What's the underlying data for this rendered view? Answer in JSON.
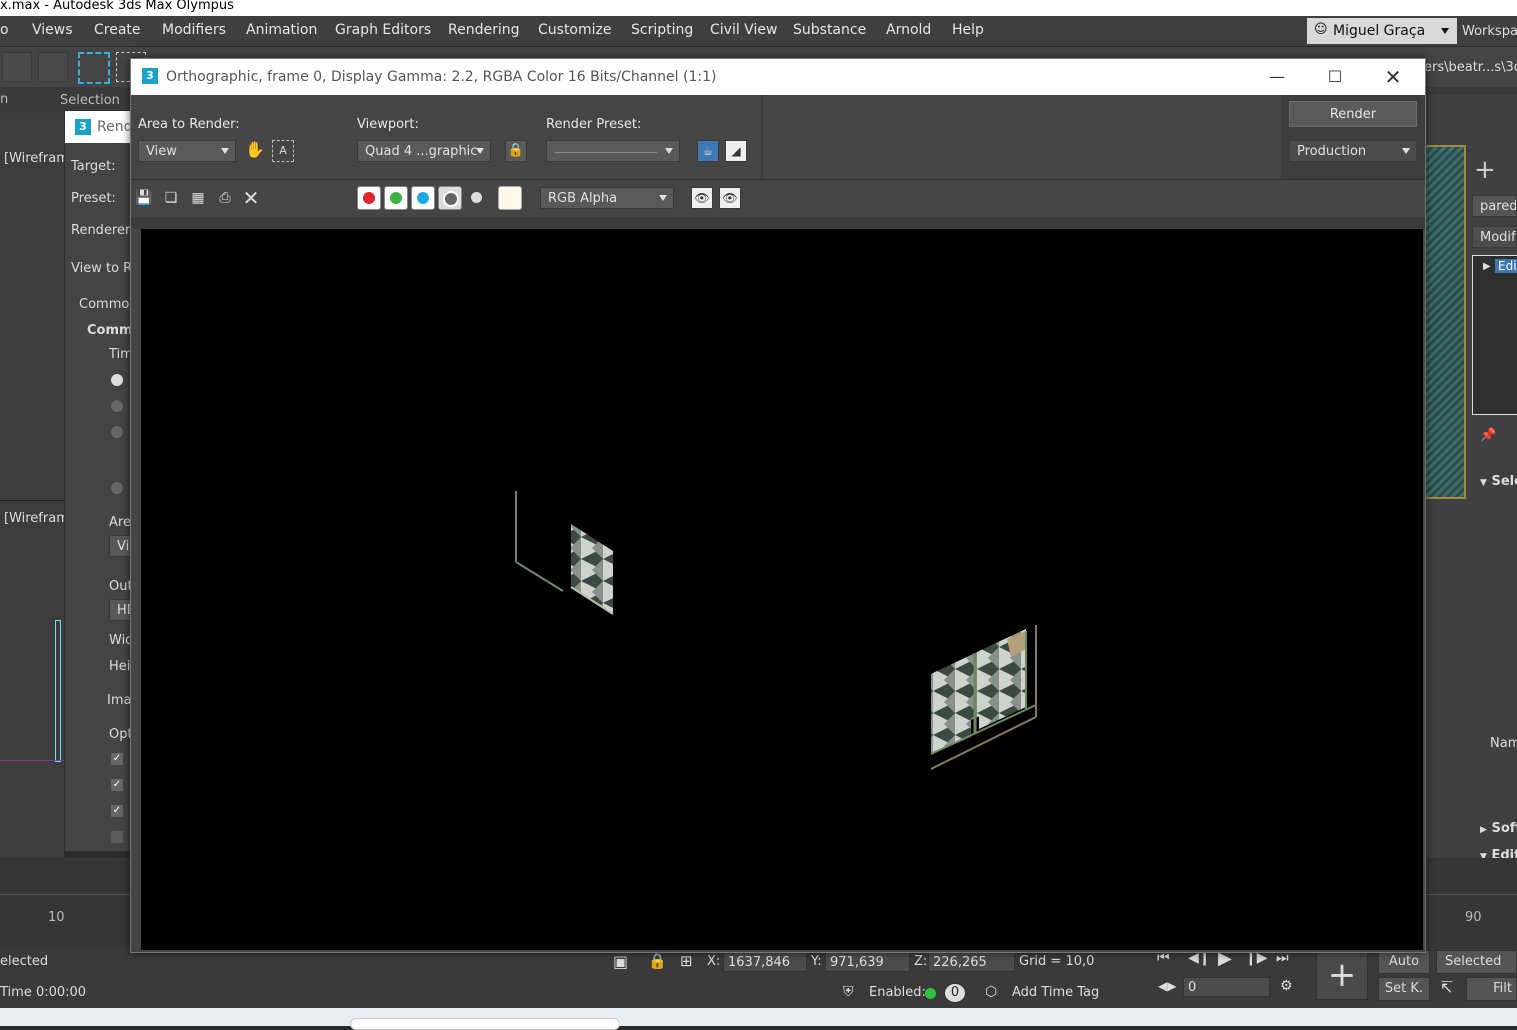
{
  "app": {
    "title": "x.max - Autodesk 3ds Max Olympus"
  },
  "menu": {
    "items": [
      "o",
      "Views",
      "Create",
      "Modifiers",
      "Animation",
      "Graph Editors",
      "Rendering",
      "Customize",
      "Scripting",
      "Civil View",
      "Substance",
      "Arnold",
      "Help"
    ],
    "user": "Miguel Graça",
    "workspace": "Workspa"
  },
  "ribbon": {
    "left_label": "n",
    "selection_label": "Selection",
    "path": "ers\\beatr...s\\3ds"
  },
  "left_viewport": {
    "label1": "[Wirefram",
    "label2": "[Wirefram"
  },
  "render_setup": {
    "title": "Rend",
    "target": "Target:",
    "preset": "Preset:",
    "renderer": "Renderer:",
    "view_to": "View to Re",
    "tab_common": "Common",
    "rollout_common": "Commo",
    "time": "Tim",
    "area": "Area",
    "area_val": "Vie",
    "output": "Outp",
    "output_val": "HD",
    "width": "Wid",
    "height": "Heig",
    "image": "Ima",
    "options": "Opti"
  },
  "frame_window": {
    "title": "Orthographic, frame 0, Display Gamma: 2.2, RGBA Color 16 Bits/Channel (1:1)",
    "badge": "3",
    "area_label": "Area to Render:",
    "area_value": "View",
    "viewport_label": "Viewport:",
    "viewport_value": "Quad 4 ...graphic",
    "preset_label": "Render Preset:",
    "preset_value": "",
    "render_button": "Render",
    "production_value": "Production",
    "channel_value": "RGB Alpha"
  },
  "right_panel": {
    "name_field": "parede",
    "modifier": "Modifie",
    "stack_item": "Edi",
    "sel": "Sele",
    "name": "Nam",
    "soft": "Soft",
    "edit": "Edit"
  },
  "timeline": {
    "tick_left": "10",
    "tick_right": "90"
  },
  "status": {
    "selected_left": "elected",
    "time_label": "Time  0:00:00",
    "x_label": "X:",
    "x_value": "1637,846",
    "y_label": "Y:",
    "y_value": "971,639",
    "z_label": "Z:",
    "z_value": "226,265",
    "grid": "Grid = 10,0",
    "enabled": "Enabled:",
    "add_time_tag": "Add Time Tag",
    "frame_value": "0",
    "auto": "Auto",
    "selected": "Selected",
    "set_key": "Set K.",
    "filters": "Filt"
  }
}
